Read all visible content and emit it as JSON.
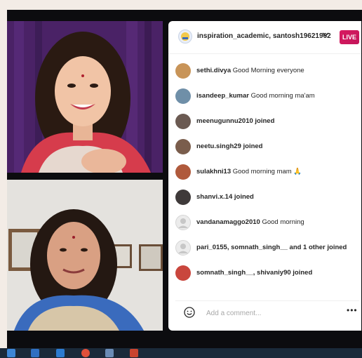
{
  "stream": {
    "title": "inspiration_academic, santosh19621962",
    "live_label": "LIVE"
  },
  "comments": [
    {
      "user": "sethi.divya",
      "text": "Good Morning everyone",
      "avatar_color": "#c89458"
    },
    {
      "user": "isandeep_kumar",
      "text": "Good morning ma'am",
      "avatar_color": "#6f8fa8"
    },
    {
      "user": "meenugunnu2010",
      "text": "joined",
      "avatar_color": "#6b5a52"
    },
    {
      "user": "neetu.singh29",
      "text": "joined",
      "avatar_color": "#7a5d4c"
    },
    {
      "user": "sulakhni13",
      "text": "Good morning mam 🙏",
      "avatar_color": "#b05a3c"
    },
    {
      "user": "shanvi.x.14",
      "text": "joined",
      "avatar_color": "#3f3a3a"
    },
    {
      "user": "vandanamaggo2010",
      "text": "Good morning",
      "avatar_color": "#e3e3e3"
    },
    {
      "user": "pari_0155, somnath_singh__",
      "text": "and 1 other joined",
      "avatar_color": "#e3e3e3"
    },
    {
      "user": "somnath_singh__, shivaniy90",
      "text": "joined",
      "avatar_color": "#c9463d"
    }
  ],
  "comment_box": {
    "placeholder": "Add a comment...",
    "more_label": "•••"
  },
  "icons": {
    "emoji": "smiley-icon",
    "chevron": "chevron-down-icon"
  },
  "colors": {
    "live_badge": "#d81b60",
    "background": "#0c0c0f"
  }
}
